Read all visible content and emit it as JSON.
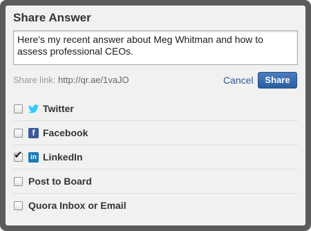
{
  "dialog": {
    "title": "Share Answer",
    "message": "Here's my recent answer about Meg Whitman and how to assess professional CEOs.",
    "share_link_label": "Share link:",
    "share_link_url": "http://qr.ae/1vaJO",
    "cancel_label": "Cancel",
    "share_label": "Share"
  },
  "options": [
    {
      "label": "Twitter",
      "checked": false,
      "icon": "twitter-icon",
      "color": "#33ccff"
    },
    {
      "label": "Facebook",
      "checked": false,
      "icon": "facebook-icon",
      "color": "#3b5998"
    },
    {
      "label": "LinkedIn",
      "checked": true,
      "icon": "linkedin-icon",
      "color": "#1b7bb5"
    },
    {
      "label": "Post to Board",
      "checked": false
    },
    {
      "label": "Quora Inbox or Email",
      "checked": false
    }
  ],
  "colors": {
    "frame": "#5b5b5b",
    "background": "#f1f1f1",
    "accent": "#2b5a93",
    "button": "#3a6eb0"
  }
}
